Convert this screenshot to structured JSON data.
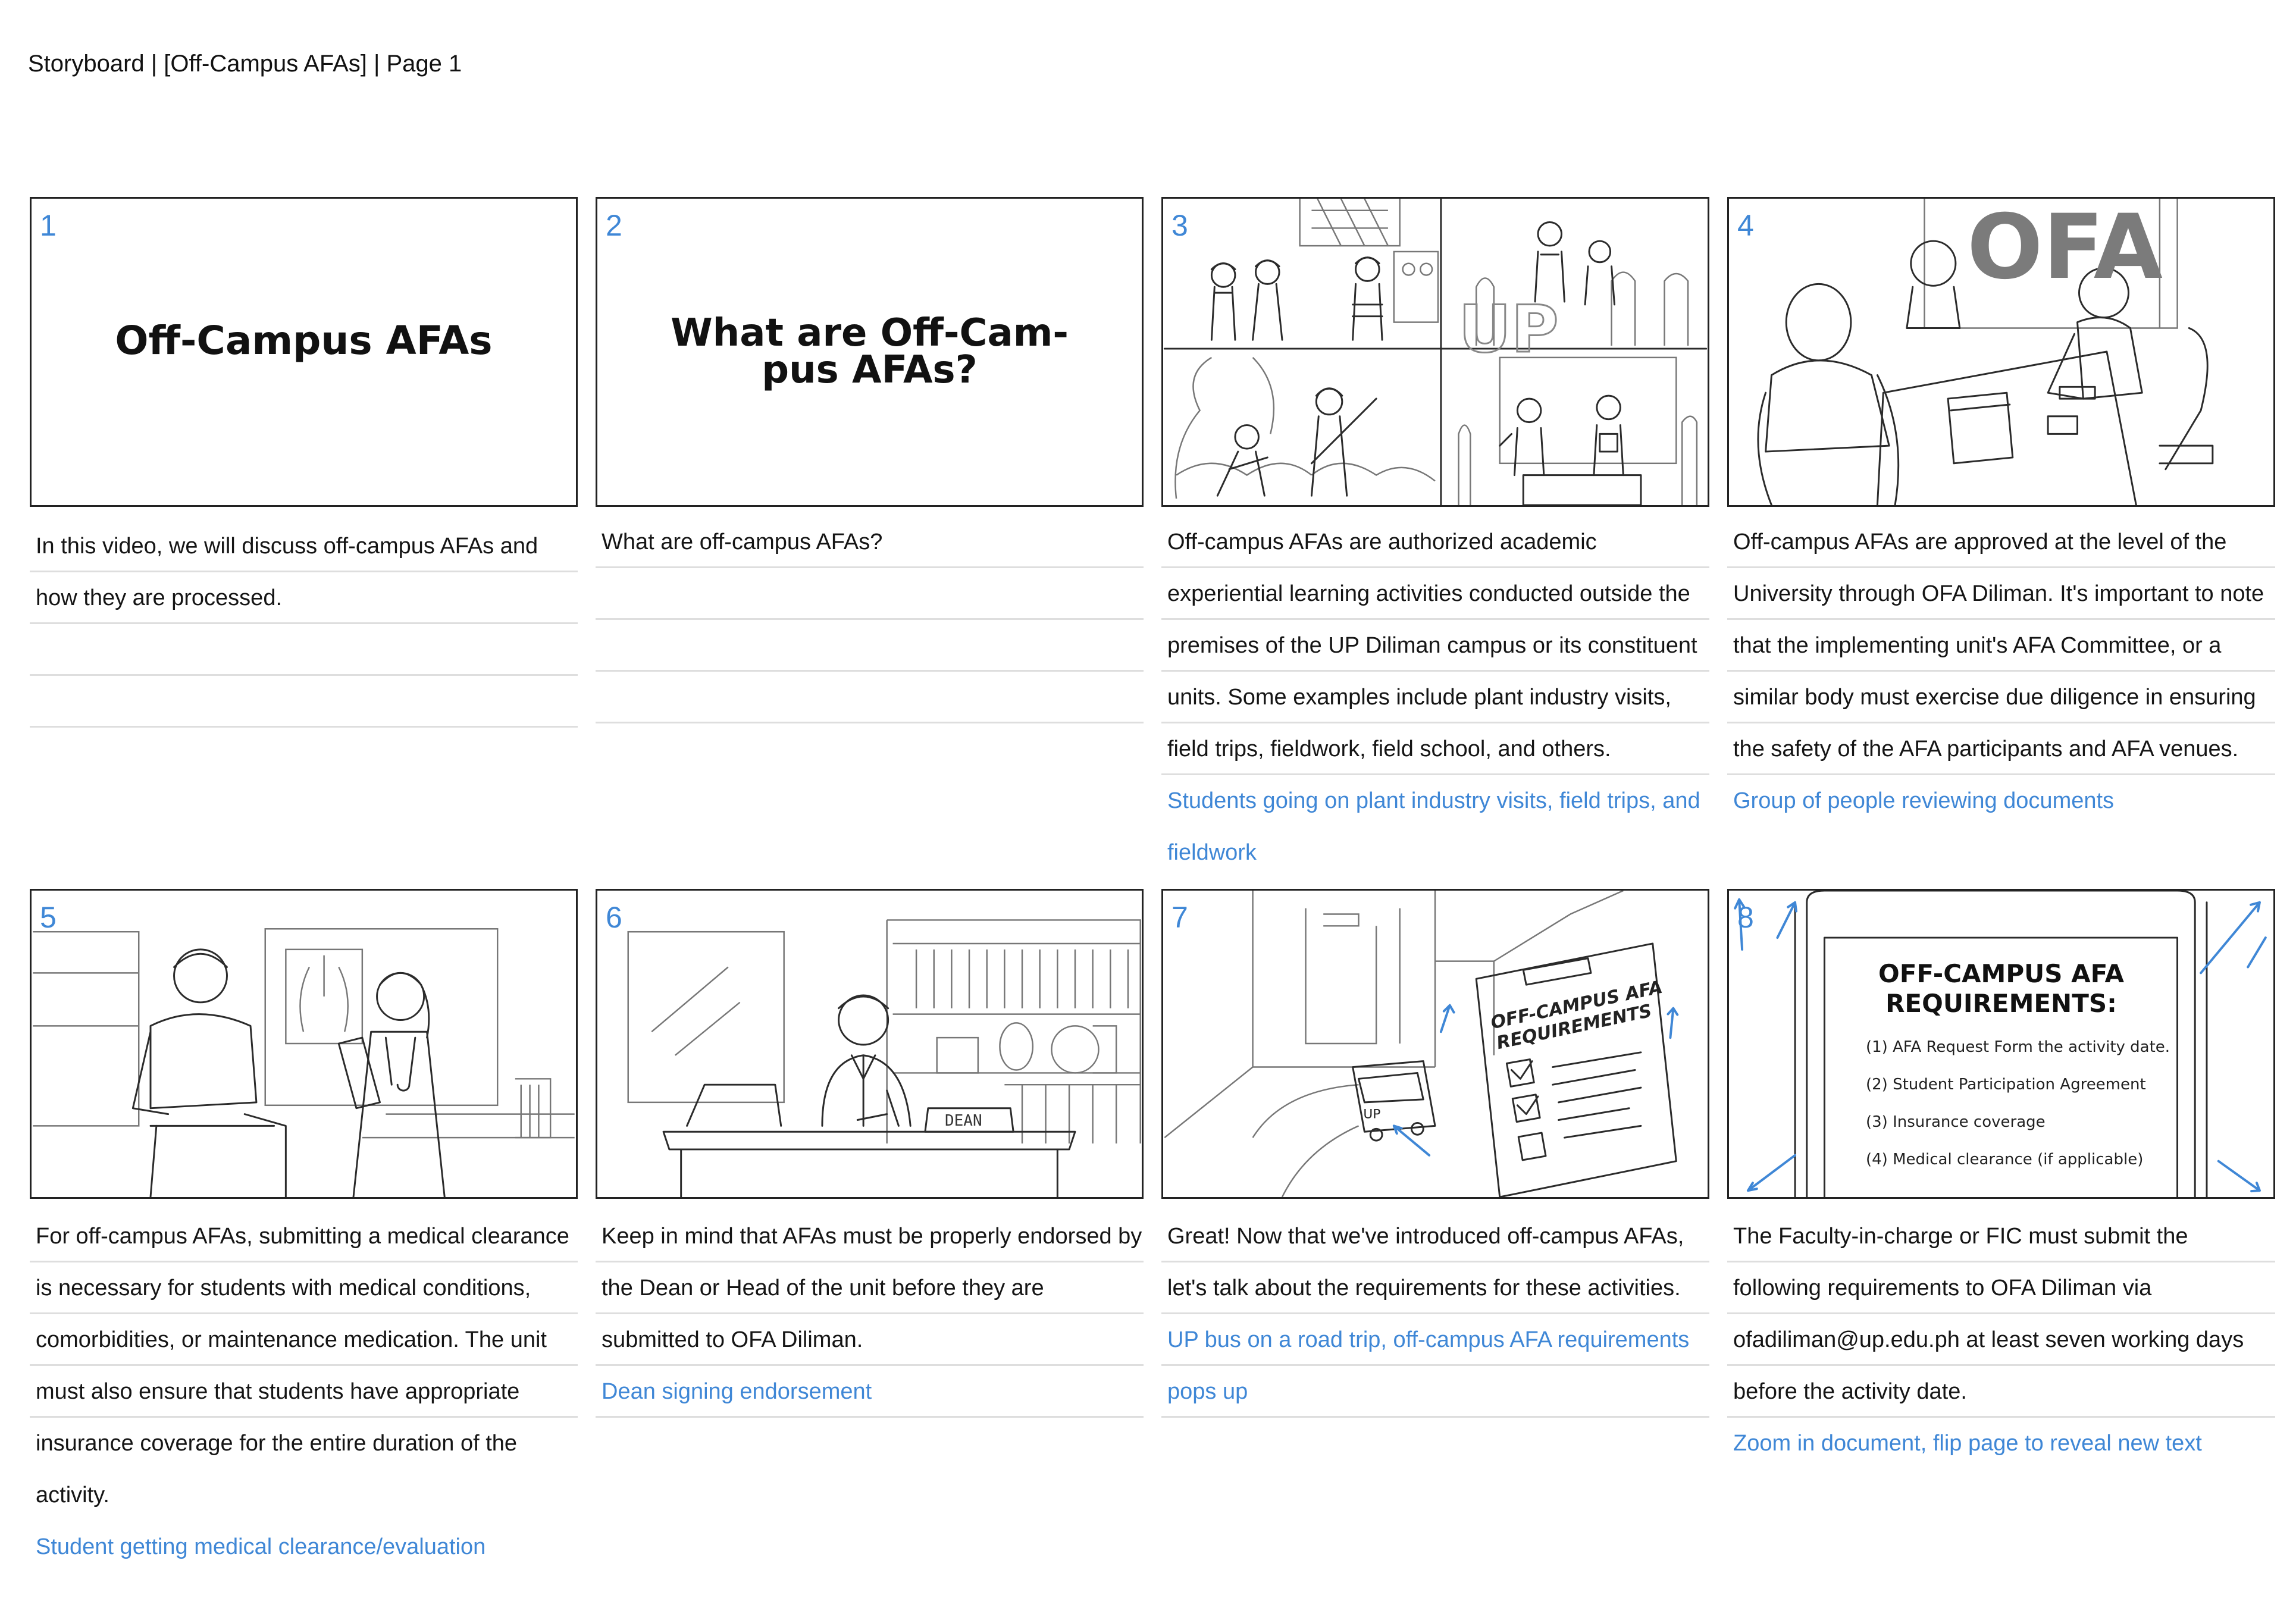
{
  "header": {
    "title": "Storyboard | [Off-Campus AFAs] | Page 1"
  },
  "panels": [
    {
      "number": "1",
      "title": "Off-Campus AFAs",
      "lines": [
        "In this video, we will discuss off-campus AFAs and",
        "how they are processed.",
        "",
        ""
      ],
      "note_lines": []
    },
    {
      "number": "2",
      "title_line1": "What are Off-Cam-",
      "title_line2": "pus AFAs?",
      "lines": [
        "What are off-campus AFAs?",
        "",
        "",
        ""
      ],
      "note_lines": []
    },
    {
      "number": "3",
      "sign_text": "UP",
      "lines": [
        "Off-campus AFAs are authorized academic",
        "experiential learning activities conducted outside the",
        "premises of the UP Diliman campus or its constituent",
        "units. Some examples include plant industry visits,",
        "field trips, fieldwork, field school, and others."
      ],
      "note_lines": [
        "Students going on plant industry visits, field trips, and",
        "fieldwork"
      ]
    },
    {
      "number": "4",
      "sign_text": "OFA",
      "lines": [
        "Off-campus AFAs are approved at the level of the",
        "University through OFA Diliman. It's important to note",
        "that the implementing unit's AFA Committee, or a",
        "similar body must exercise due diligence in ensuring",
        "the safety of the AFA participants and AFA venues."
      ],
      "note_lines": [
        "Group of people reviewing documents"
      ]
    },
    {
      "number": "5",
      "lines": [
        "For off-campus AFAs, submitting a medical clearance",
        "is necessary for students with medical conditions,",
        "comorbidities, or maintenance medication. The unit",
        "must also ensure that students have appropriate",
        "insurance coverage for the entire duration of the",
        "activity."
      ],
      "note_lines": [
        "Student getting medical clearance/evaluation"
      ]
    },
    {
      "number": "6",
      "plate_text": "DEAN",
      "lines": [
        "Keep in mind that AFAs must be properly endorsed by",
        "the Dean or Head of the unit before they are",
        "submitted to OFA Diliman."
      ],
      "note_lines": [
        "Dean signing endorsement"
      ]
    },
    {
      "number": "7",
      "clip_line1": "OFF-CAMPUS AFA",
      "clip_line2": "REQUIREMENTS",
      "bus_text": "UP",
      "lines": [
        "Great! Now that we've introduced off-campus AFAs,",
        "let's talk about the requirements for these activities."
      ],
      "note_lines": [
        "UP bus on a road trip, off-campus AFA requirements",
        "pops up"
      ]
    },
    {
      "number": "8",
      "doc_title_line1": "OFF-CAMPUS AFA",
      "doc_title_line2": "REQUIREMENTS:",
      "doc_items": [
        "(1) AFA Request Form the activity date.",
        "(2) Student Participation Agreement",
        "(3) Insurance coverage",
        "(4) Medical clearance (if applicable)"
      ],
      "lines": [
        "The Faculty-in-charge or FIC must submit the",
        "following requirements to OFA Diliman via",
        "ofadiliman@up.edu.ph at least seven working days",
        "before the activity date."
      ],
      "note_lines": [
        "Zoom in document, flip page to reveal new text"
      ]
    }
  ],
  "colors": {
    "accent_blue": "#3f87d6",
    "frame": "#222222",
    "rule": "#dedede"
  }
}
